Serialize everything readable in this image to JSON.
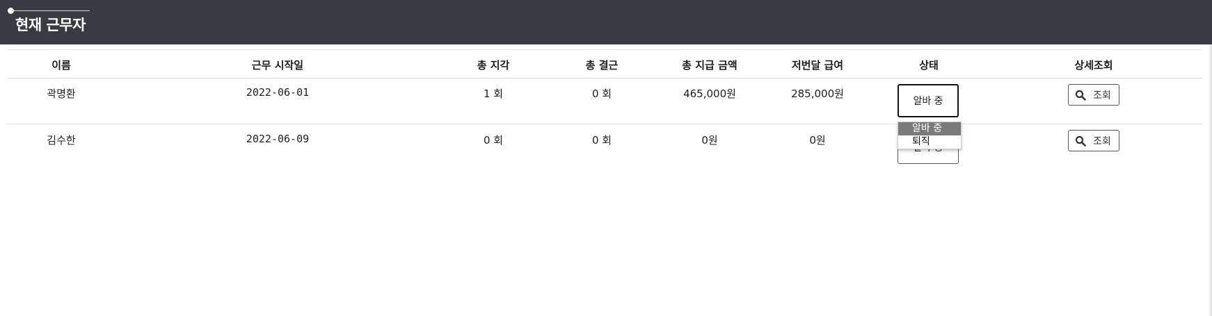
{
  "header": {
    "title": "현재 근무자"
  },
  "table": {
    "columns": [
      "이름",
      "근무 시작일",
      "총 지각",
      "총 결근",
      "총 지급 금액",
      "저번달 급여",
      "상태",
      "상세조회"
    ],
    "rows": [
      {
        "name": "곽명환",
        "start_date": "2022-06-01",
        "late": "1 회",
        "absent": "0 회",
        "total_paid": "465,000원",
        "last_month_pay": "285,000원",
        "status": "알바 중",
        "view_label": "조회"
      },
      {
        "name": "김수한",
        "start_date": "2022-06-09",
        "late": "0 회",
        "absent": "0 회",
        "total_paid": "0원",
        "last_month_pay": "0원",
        "status": "알바 중",
        "view_label": "조회"
      }
    ]
  },
  "status_dropdown": {
    "options": [
      "알바 중",
      "퇴직"
    ],
    "selected": "알바 중"
  },
  "icons": {
    "view": "search-icon"
  },
  "colors": {
    "header_bg": "#393a42",
    "selected_option_bg": "#7a7a7a"
  }
}
